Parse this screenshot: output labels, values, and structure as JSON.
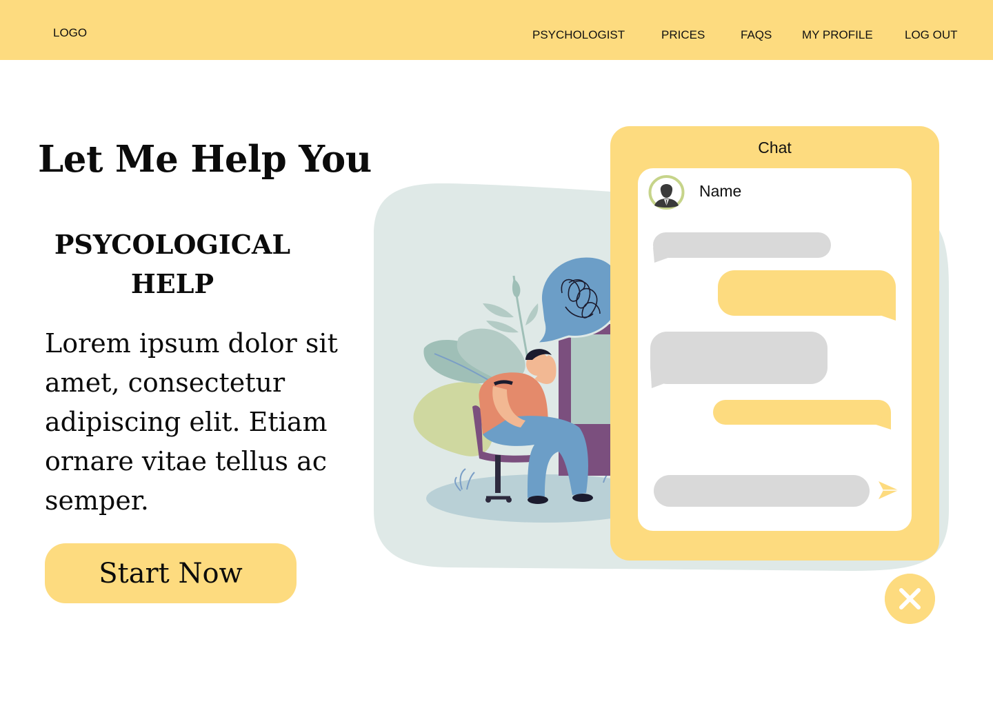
{
  "header": {
    "logo": "LOGO",
    "nav": [
      "PSYCHOLOGIST",
      "PRICES",
      "FAQS",
      "MY PROFILE",
      "LOG OUT"
    ]
  },
  "hero": {
    "title": "Let Me Help You",
    "subtitle": "PSYCOLOGICAL HELP",
    "body": "Lorem ipsum dolor sit amet, consectetur adipiscing elit. Etiam ornare vitae tellus ac semper.",
    "cta": "Start Now"
  },
  "chat": {
    "title": "Chat",
    "contact_name": "Name",
    "input_value": "",
    "messages": [
      {
        "from": "received",
        "text": ""
      },
      {
        "from": "sent",
        "text": ""
      },
      {
        "from": "received",
        "text": ""
      },
      {
        "from": "sent",
        "text": ""
      }
    ]
  },
  "icons": {
    "send": "send-icon",
    "close": "close-icon",
    "avatar": "user-avatar-icon"
  },
  "colors": {
    "accent": "#fddb7f",
    "bubble_received": "#d9d9d9",
    "bubble_sent": "#fddb7f",
    "illustration_bg": "#dfe9e7"
  }
}
